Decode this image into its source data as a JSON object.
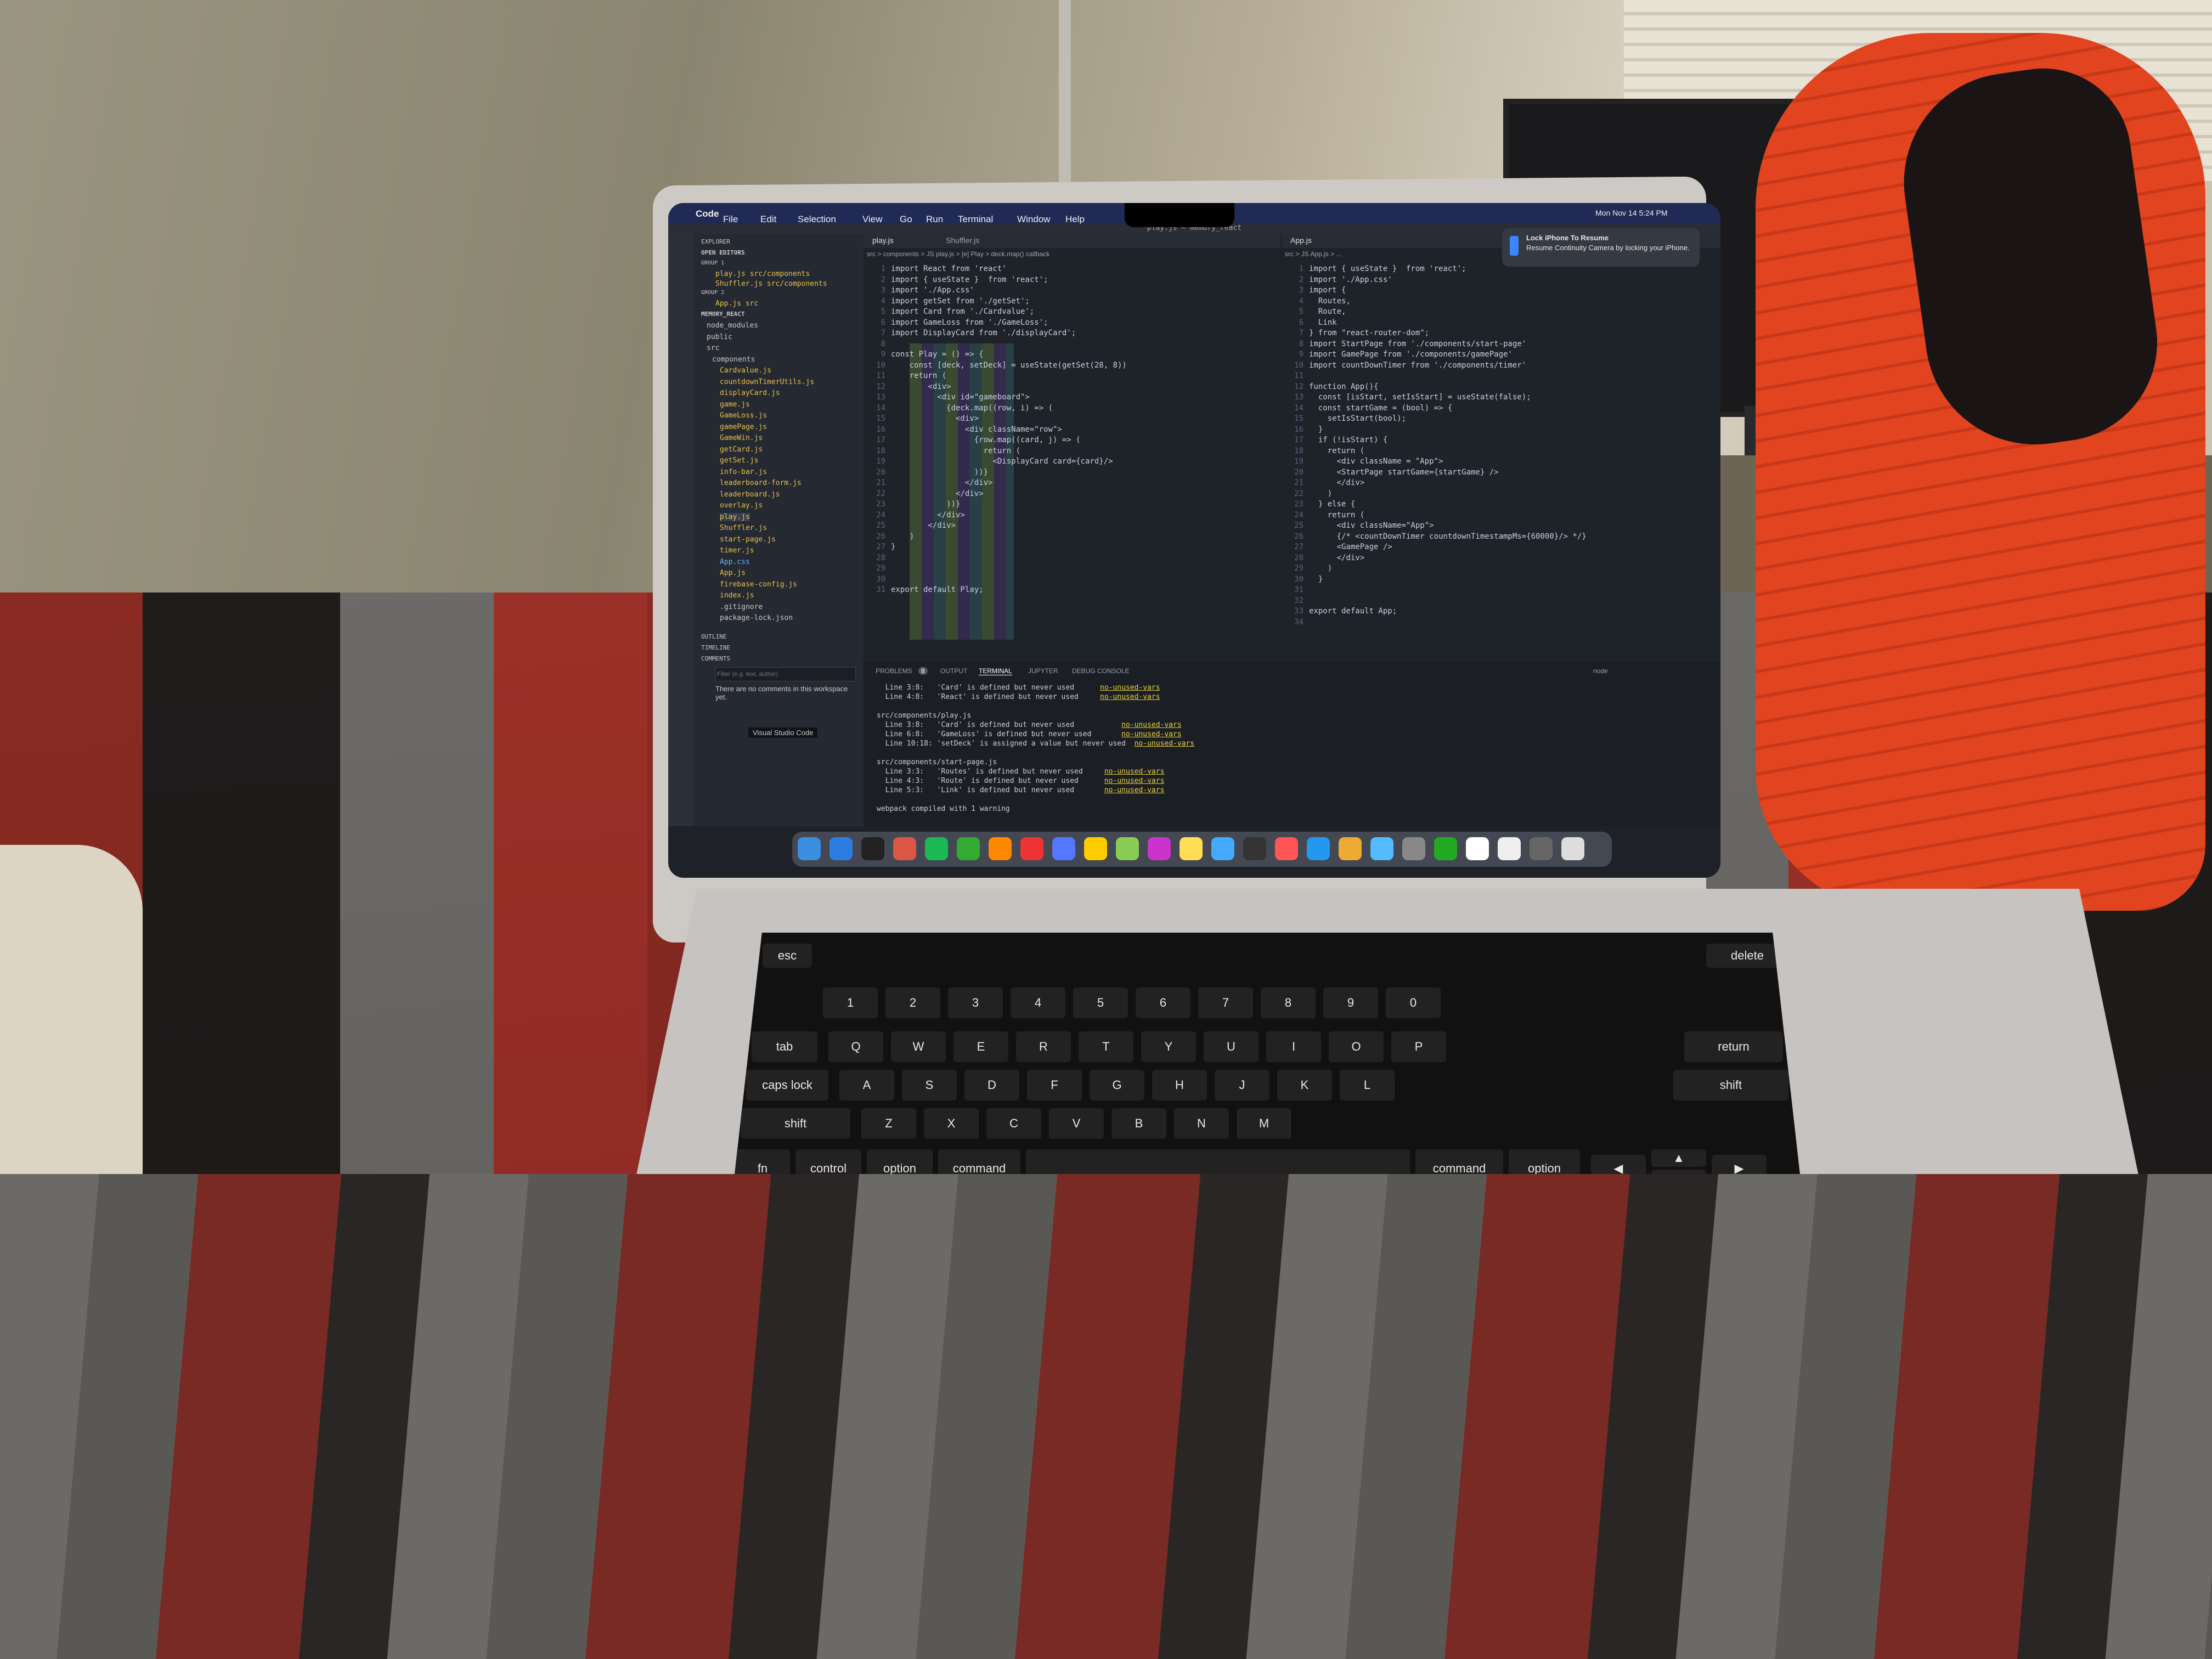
{
  "scene": {
    "description_free": true
  },
  "menubar": {
    "apple": "",
    "app": "Code",
    "items": [
      "File",
      "Edit",
      "Selection",
      "View",
      "Go",
      "Run",
      "Terminal",
      "Window",
      "Help"
    ],
    "datetime": "Mon Nov 14  5:24 PM"
  },
  "window_title": "play.js — memory_react",
  "notification": {
    "title": "Lock iPhone To Resume",
    "body": "Resume Continuity Camera by locking your iPhone."
  },
  "sidebar": {
    "header": "EXPLORER",
    "open_editors": "OPEN EDITORS",
    "group1": "GROUP 1",
    "group1_files": [
      "play.js src/components",
      "Shuffler.js src/components"
    ],
    "group2": "GROUP 2",
    "group2_files": [
      "App.js src"
    ],
    "project": "MEMORY_REACT",
    "tree": [
      "node_modules",
      "public",
      "src",
      "components",
      "Cardvalue.js",
      "countdownTimerUtils.js",
      "displayCard.js",
      "game.js",
      "GameLoss.js",
      "gamePage.js",
      "GameWin.js",
      "getCard.js",
      "getSet.js",
      "info-bar.js",
      "leaderboard-form.js",
      "leaderboard.js",
      "overlay.js",
      "play.js",
      "Shuffler.js",
      "start-page.js",
      "timer.js",
      "App.css",
      "App.js",
      "firebase-config.js",
      "index.js",
      ".gitignore",
      "package-lock.json"
    ],
    "outline": "OUTLINE",
    "timeline": "TIMELINE",
    "comments": "COMMENTS",
    "filter_placeholder": "Filter (e.g. text, author)",
    "no_comments": "There are no comments in this workspace yet.",
    "vscode_label": "Visual Studio Code"
  },
  "editor1": {
    "tabs": [
      "play.js",
      "Shuffler.js"
    ],
    "breadcrumb": "src > components > JS play.js > [e] Play > deck.map() callback",
    "lines": [
      "import React from 'react'",
      "import { useState }  from 'react';",
      "import './App.css'",
      "import getSet from './getSet';",
      "import Card from './Cardvalue';",
      "import GameLoss from './GameLoss';",
      "import DisplayCard from './displayCard';",
      "",
      "const Play = () => {",
      "    const [deck, setDeck] = useState(getSet(28, 8))",
      "    return (",
      "        <div>",
      "          <div id=\"gameboard\">",
      "            {deck.map((row, i) => (",
      "              <div>",
      "                <div className=\"row\">",
      "                  {row.map((card, j) => (",
      "                    return (",
      "                      <DisplayCard card={card}/>",
      "                  ))}",
      "                </div>",
      "              </div>",
      "            ))}",
      "          </div>",
      "        </div>",
      "    )",
      "}",
      "",
      "",
      "",
      "export default Play;"
    ]
  },
  "editor2": {
    "tabs": [
      "App.js"
    ],
    "breadcrumb": "src > JS App.js > ...",
    "lines": [
      "import { useState }  from 'react';",
      "import './App.css'",
      "import {",
      "  Routes,",
      "  Route,",
      "  Link",
      "} from \"react-router-dom\";",
      "import StartPage from './components/start-page'",
      "import GamePage from './components/gamePage'",
      "import countDownTimer from './components/timer'",
      "",
      "function App(){",
      "  const [isStart, setIsStart] = useState(false);",
      "  const startGame = (bool) => {",
      "    setIsStart(bool);",
      "  }",
      "  if (!isStart) {",
      "    return (",
      "      <div className = \"App\">",
      "      <StartPage startGame={startGame} />",
      "      </div>",
      "    )",
      "  } else {",
      "    return (",
      "      <div className=\"App\">",
      "      {/* <countDownTimer countdownTimestampMs={60000}/> */}",
      "      <GamePage />",
      "      </div>",
      "    )",
      "  }",
      "",
      "",
      "export default App;",
      ""
    ]
  },
  "panel": {
    "tabs": [
      "PROBLEMS",
      "OUTPUT",
      "TERMINAL",
      "JUPYTER",
      "DEBUG CONSOLE"
    ],
    "problems_count": "8",
    "shell_label": "node",
    "lines": [
      {
        "text": "  Line 3:8:   'Card' is defined but never used      ",
        "rule": "no-unused-vars"
      },
      {
        "text": "  Line 4:8:   'React' is defined but never used     ",
        "rule": "no-unused-vars"
      },
      {
        "text": "",
        "rule": ""
      },
      {
        "text": "src/components/play.js",
        "rule": ""
      },
      {
        "text": "  Line 3:8:   'Card' is defined but never used           ",
        "rule": "no-unused-vars"
      },
      {
        "text": "  Line 6:8:   'GameLoss' is defined but never used       ",
        "rule": "no-unused-vars"
      },
      {
        "text": "  Line 10:18: 'setDeck' is assigned a value but never used  ",
        "rule": "no-unused-vars"
      },
      {
        "text": "",
        "rule": ""
      },
      {
        "text": "src/components/start-page.js",
        "rule": ""
      },
      {
        "text": "  Line 3:3:   'Routes' is defined but never used     ",
        "rule": "no-unused-vars"
      },
      {
        "text": "  Line 4:3:   'Route' is defined but never used      ",
        "rule": "no-unused-vars"
      },
      {
        "text": "  Line 5:3:   'Link' is defined but never used       ",
        "rule": "no-unused-vars"
      },
      {
        "text": "",
        "rule": ""
      },
      {
        "text": "webpack compiled with 1 warning",
        "rule": ""
      }
    ]
  },
  "keyboard": {
    "esc": "esc",
    "delete": "delete",
    "tab": "tab",
    "caps": "caps lock",
    "return": "return",
    "shift": "shift",
    "fn": "fn",
    "control": "control",
    "option": "option",
    "command": "command",
    "row1": [
      "Q",
      "W",
      "E",
      "R",
      "T",
      "Y",
      "U",
      "I",
      "O",
      "P"
    ],
    "row2": [
      "A",
      "S",
      "D",
      "F",
      "G",
      "H",
      "J",
      "K",
      "L"
    ],
    "row3": [
      "Z",
      "X",
      "C",
      "V",
      "B",
      "N",
      "M"
    ],
    "numbers": [
      "1",
      "2",
      "3",
      "4",
      "5",
      "6",
      "7",
      "8",
      "9",
      "0"
    ]
  },
  "colors": {
    "menubar": "#202a54",
    "editor_bg": "#1e2229",
    "warning": "#e8d23a",
    "jacket": "#e24420"
  }
}
